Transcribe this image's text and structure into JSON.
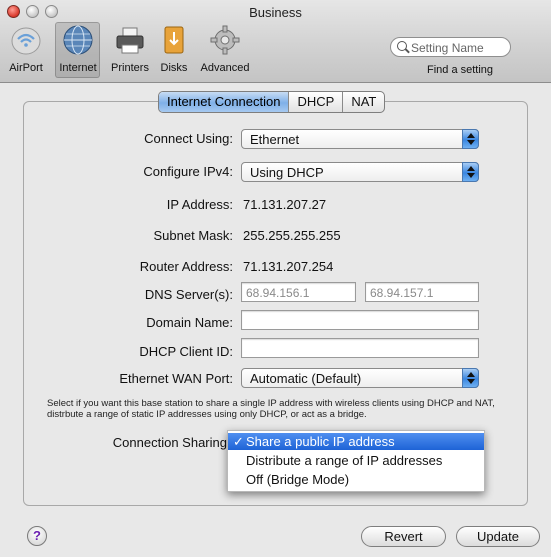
{
  "window": {
    "title": "Business"
  },
  "toolbar": {
    "items": [
      {
        "label": "AirPort",
        "icon": "airport-icon"
      },
      {
        "label": "Internet",
        "icon": "internet-globe-icon",
        "selected": true
      },
      {
        "label": "Printers",
        "icon": "printer-icon"
      },
      {
        "label": "Disks",
        "icon": "disk-icon"
      },
      {
        "label": "Advanced",
        "icon": "gear-icon"
      }
    ],
    "search_placeholder": "Setting Name",
    "find_label": "Find a setting"
  },
  "tabs": [
    {
      "label": "Internet Connection",
      "active": true
    },
    {
      "label": "DHCP",
      "active": false
    },
    {
      "label": "NAT",
      "active": false
    }
  ],
  "form": {
    "connect_using_label": "Connect Using:",
    "connect_using_value": "Ethernet",
    "configure_ipv4_label": "Configure IPv4:",
    "configure_ipv4_value": "Using DHCP",
    "ip_address_label": "IP Address:",
    "ip_address_value": "71.131.207.27",
    "subnet_mask_label": "Subnet Mask:",
    "subnet_mask_value": "255.255.255.255",
    "router_address_label": "Router Address:",
    "router_address_value": "71.131.207.254",
    "dns_label": "DNS Server(s):",
    "dns_primary": "68.94.156.1",
    "dns_secondary": "68.94.157.1",
    "domain_name_label": "Domain Name:",
    "domain_name_value": "",
    "dhcp_client_id_label": "DHCP Client ID:",
    "dhcp_client_id_value": "",
    "wan_port_label": "Ethernet WAN Port:",
    "wan_port_value": "Automatic (Default)",
    "info_text": "Select if you want this base station to share a single IP address with wireless clients using DHCP and NAT, distrbute a range of static IP addresses using only DHCP, or act as a bridge.",
    "connection_sharing_label": "Connection Sharing",
    "connection_sharing_options": [
      {
        "label": "Share a public IP address",
        "selected": true,
        "check": "✓"
      },
      {
        "label": "Distribute a range of IP addresses",
        "selected": false
      },
      {
        "label": "Off (Bridge Mode)",
        "selected": false
      }
    ]
  },
  "buttons": {
    "help": "?",
    "revert": "Revert",
    "update": "Update"
  },
  "colors": {
    "accent": "#3a86e0",
    "selection": "#1e63d6"
  }
}
